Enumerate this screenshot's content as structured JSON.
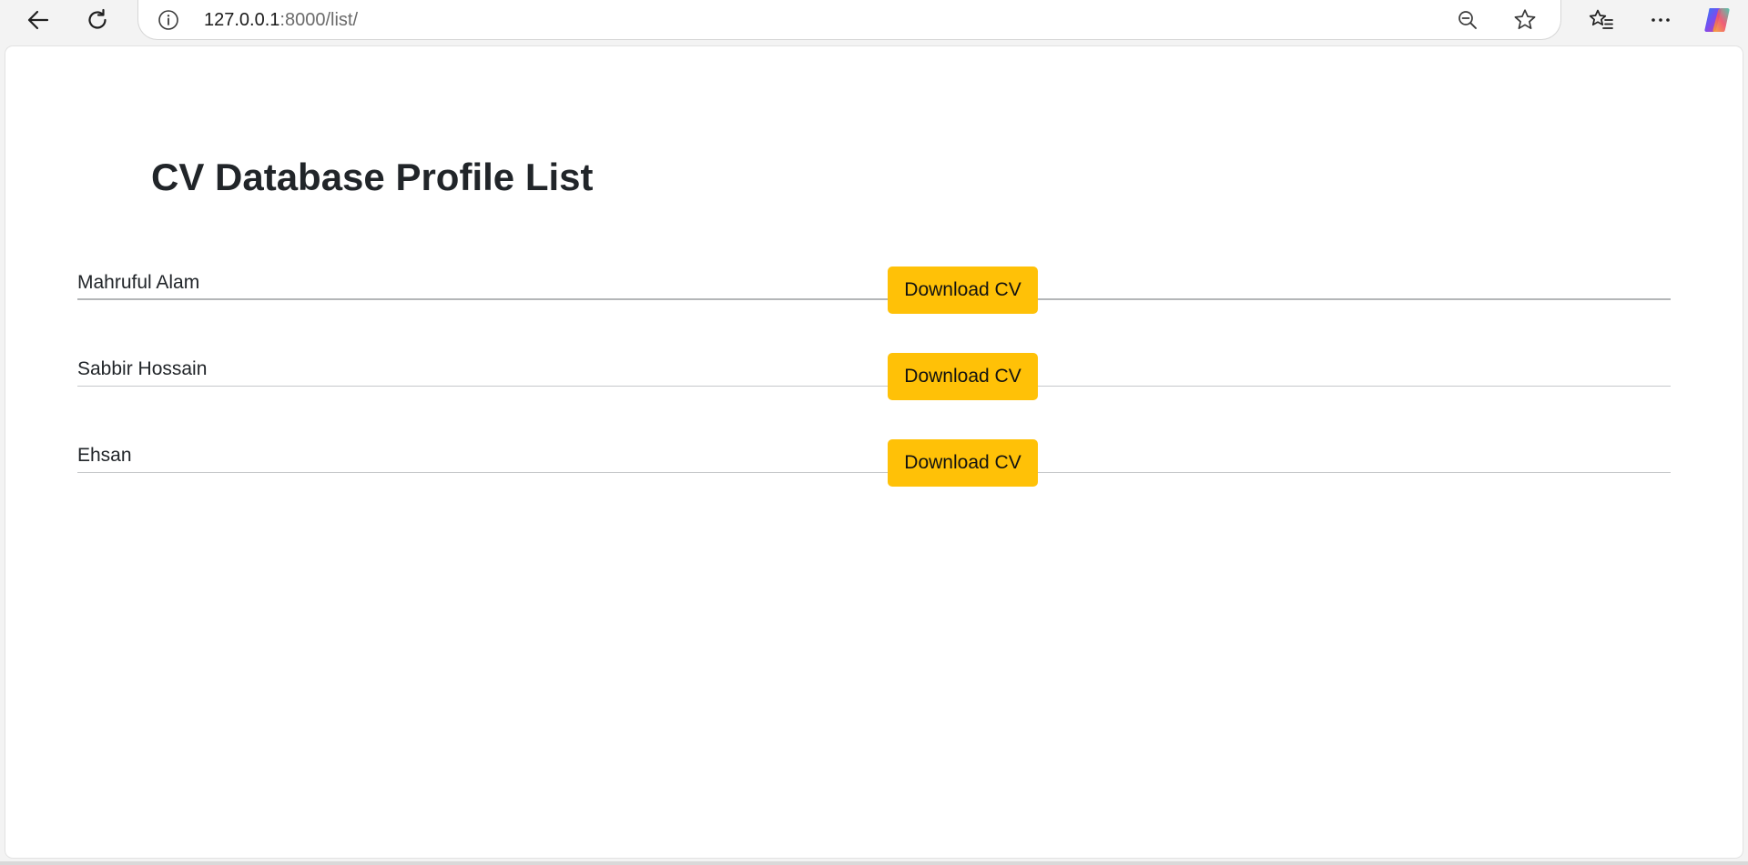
{
  "browser": {
    "url_host": "127.0.0.1",
    "url_rest": ":8000/list/",
    "icons": {
      "back": "back-arrow-icon",
      "reload": "reload-icon",
      "site_info": "info-icon",
      "zoom": "zoom-out-icon",
      "favorite": "star-icon",
      "favorites": "favorites-list-icon",
      "more": "more-dots-icon",
      "copilot": "copilot-icon"
    }
  },
  "page": {
    "title": "CV Database Profile List",
    "profiles": [
      {
        "name": "Mahruful Alam",
        "button_label": "Download CV"
      },
      {
        "name": "Sabbir Hossain",
        "button_label": "Download CV"
      },
      {
        "name": "Ehsan",
        "button_label": "Download CV"
      }
    ]
  },
  "colors": {
    "button_background": "#ffc107",
    "text": "#212529",
    "divider": "#c6c8ca"
  }
}
